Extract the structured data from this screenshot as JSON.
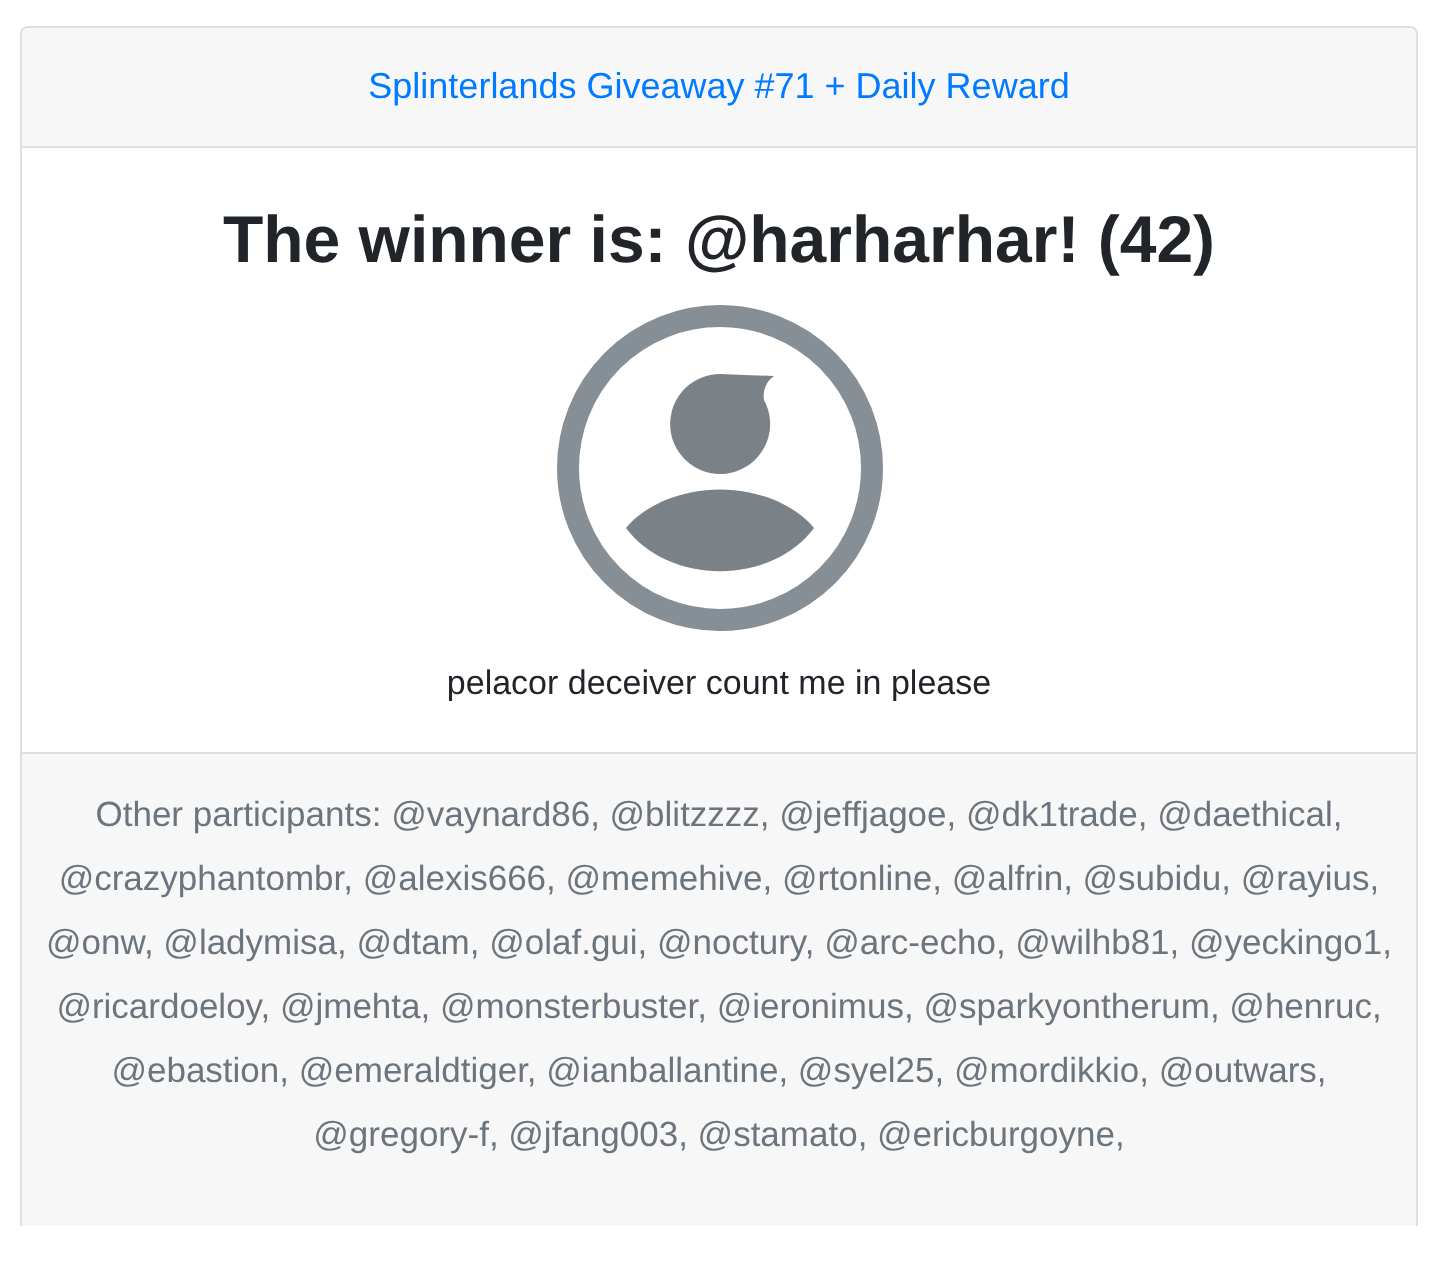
{
  "header": {
    "link": "Splinterlands Giveaway #71 + Daily Reward"
  },
  "winner": {
    "title": "The winner is: @harharhar! (42)",
    "comment": "pelacor deceiver count me in please"
  },
  "footer": {
    "participants": "Other participants: @vaynard86, @blitzzzz, @jeffjagoe, @dk1trade, @daethical, @crazyphantombr, @alexis666, @memehive, @rtonline, @alfrin, @subidu, @rayius, @onw, @ladymisa, @dtam, @olaf.gui, @noctury, @arc-echo, @wilhb81, @yeckingo1, @ricardoeloy, @jmehta, @monsterbuster, @ieronimus, @sparkyontherum, @henruc, @ebastion, @emeraldtiger, @ianballantine, @syel25, @mordikkio, @outwars, @gregory-f, @jfang003, @stamato, @ericburgoyne,"
  }
}
